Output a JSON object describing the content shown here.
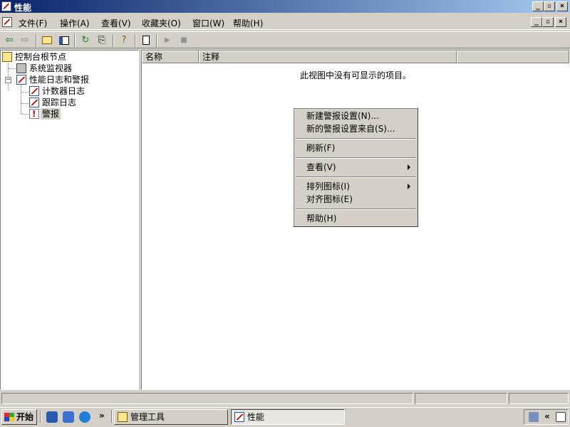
{
  "window": {
    "title": "性能"
  },
  "menubar": {
    "items": [
      "文件(F)",
      "操作(A)",
      "查看(V)",
      "收藏夹(O)",
      "窗口(W)",
      "帮助(H)"
    ]
  },
  "toolbar": {
    "buttons": [
      "back-arrow-icon",
      "forward-arrow-icon",
      "up-folder-icon",
      "show-tree-icon",
      "refresh-icon",
      "export-icon",
      "help-icon",
      "new-icon",
      "play-icon",
      "stop-icon"
    ]
  },
  "tree": {
    "root": "控制台根节点",
    "system_monitor": "系统监视器",
    "perf_logs": "性能日志和警报",
    "counter_logs": "计数器日志",
    "trace_logs": "跟踪日志",
    "alerts": "警报"
  },
  "list": {
    "columns": [
      "名称",
      "注释"
    ],
    "empty_message": "此视图中没有可显示的项目。"
  },
  "context_menu": {
    "new_alert": "新建警报设置(N)...",
    "new_alert_from": "新的警报设置来自(S)...",
    "refresh": "刷新(F)",
    "view": "查看(V)",
    "arrange_icons": "排列图标(I)",
    "line_up_icons": "对齐图标(E)",
    "help": "帮助(H)"
  },
  "taskbar": {
    "start": "开始",
    "chevron": "»",
    "tasks": [
      "管理工具",
      "性能"
    ],
    "tray_chevron": "«"
  }
}
